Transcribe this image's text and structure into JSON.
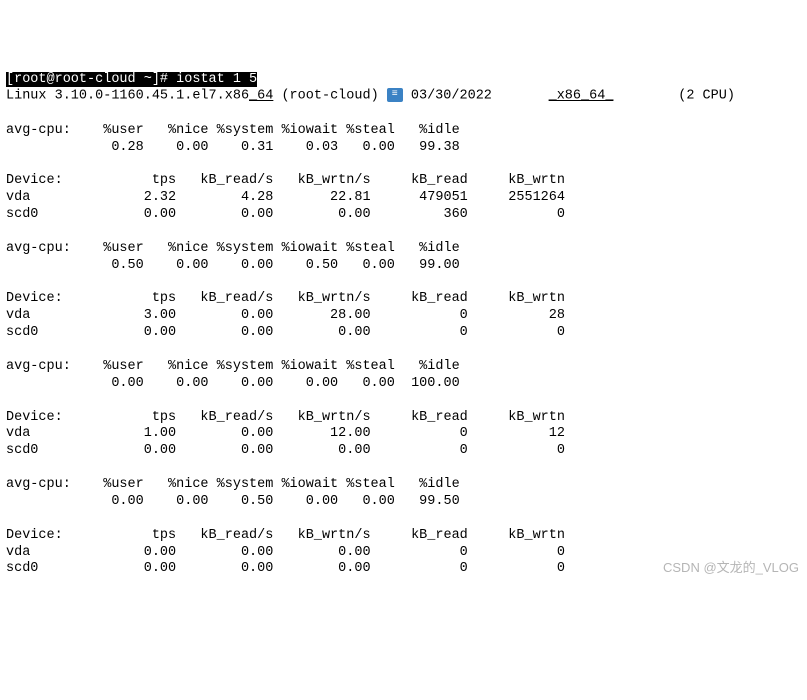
{
  "prompt": {
    "user": "root",
    "host": "root-cloud",
    "cwd": "~",
    "hash": "#",
    "cmd": "iostat 1 5"
  },
  "header": {
    "os": "Linux 3.10.0-1160.45.1.el7.x86",
    "os_suffix": "64",
    "hostname": "(root-cloud)",
    "date": "03/30/2022",
    "arch_pre": "x86",
    "arch_suf": "64",
    "cpu": "(2 CPU)"
  },
  "cpu_hdr": {
    "c0": "avg-cpu:",
    "c1": "%user",
    "c2": "%nice",
    "c3": "%system",
    "c4": "%iowait",
    "c5": "%steal",
    "c6": "%idle"
  },
  "dev_hdr": {
    "c0": "Device:",
    "c1": "tps",
    "c2": "kB_read/s",
    "c3": "kB_wrtn/s",
    "c4": "kB_read",
    "c5": "kB_wrtn"
  },
  "samples": [
    {
      "cpu": {
        "user": "0.28",
        "nice": "0.00",
        "system": "0.31",
        "iowait": "0.03",
        "steal": "0.00",
        "idle": "99.38"
      },
      "devs": [
        {
          "name": "vda",
          "tps": "2.32",
          "rs": "4.28",
          "ws": "22.81",
          "r": "479051",
          "w": "2551264"
        },
        {
          "name": "scd0",
          "tps": "0.00",
          "rs": "0.00",
          "ws": "0.00",
          "r": "360",
          "w": "0"
        }
      ]
    },
    {
      "cpu": {
        "user": "0.50",
        "nice": "0.00",
        "system": "0.00",
        "iowait": "0.50",
        "steal": "0.00",
        "idle": "99.00"
      },
      "devs": [
        {
          "name": "vda",
          "tps": "3.00",
          "rs": "0.00",
          "ws": "28.00",
          "r": "0",
          "w": "28"
        },
        {
          "name": "scd0",
          "tps": "0.00",
          "rs": "0.00",
          "ws": "0.00",
          "r": "0",
          "w": "0"
        }
      ]
    },
    {
      "cpu": {
        "user": "0.00",
        "nice": "0.00",
        "system": "0.00",
        "iowait": "0.00",
        "steal": "0.00",
        "idle": "100.00"
      },
      "devs": [
        {
          "name": "vda",
          "tps": "1.00",
          "rs": "0.00",
          "ws": "12.00",
          "r": "0",
          "w": "12"
        },
        {
          "name": "scd0",
          "tps": "0.00",
          "rs": "0.00",
          "ws": "0.00",
          "r": "0",
          "w": "0"
        }
      ]
    },
    {
      "cpu": {
        "user": "0.00",
        "nice": "0.00",
        "system": "0.50",
        "iowait": "0.00",
        "steal": "0.00",
        "idle": "99.50"
      },
      "devs": [
        {
          "name": "vda",
          "tps": "0.00",
          "rs": "0.00",
          "ws": "0.00",
          "r": "0",
          "w": "0"
        },
        {
          "name": "scd0",
          "tps": "0.00",
          "rs": "0.00",
          "ws": "0.00",
          "r": "0",
          "w": "0"
        }
      ]
    }
  ],
  "watermark": "CSDN @文龙的_VLOG",
  "icon_glyph": "≡"
}
